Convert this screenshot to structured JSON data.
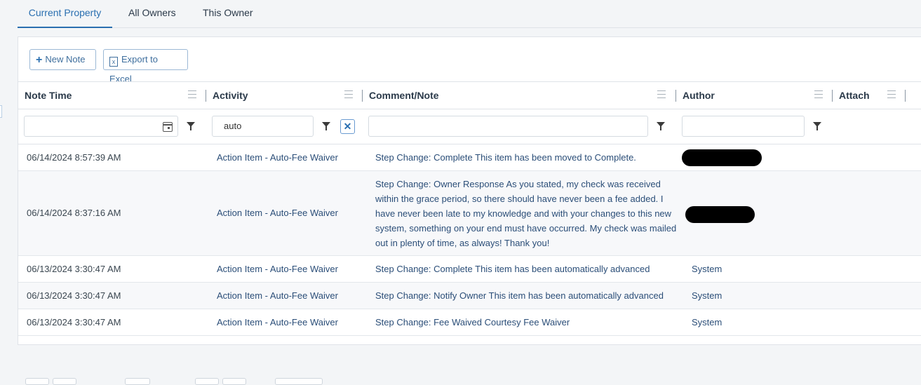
{
  "tabs": [
    {
      "label": "Current Property",
      "active": true
    },
    {
      "label": "All Owners",
      "active": false
    },
    {
      "label": "This Owner",
      "active": false
    }
  ],
  "toolbar": {
    "new_note_label": "New Note",
    "export_label": "Export to Excel"
  },
  "columns": {
    "note_time": "Note Time",
    "activity": "Activity",
    "comment": "Comment/Note",
    "author": "Author",
    "attach": "Attach"
  },
  "filters": {
    "note_time": "",
    "activity": "auto",
    "comment": "",
    "author": ""
  },
  "rows": [
    {
      "time": "06/14/2024 8:57:39 AM",
      "activity": "Action Item - Auto-Fee Waiver",
      "note": "Step Change: Complete This item has been moved to Complete.",
      "author": "",
      "author_redacted": true
    },
    {
      "time": "06/14/2024 8:37:16 AM",
      "activity": "Action Item - Auto-Fee Waiver",
      "note": "Step Change: Owner Response As you stated, my check was received within the grace period, so there should have never been a fee added. I have never been late to my knowledge and with your changes to this new system, something on your end must have occurred. My check was mailed out in plenty of time, as always! Thank you!",
      "author": "",
      "author_redacted": true
    },
    {
      "time": "06/13/2024 3:30:47 AM",
      "activity": "Action Item - Auto-Fee Waiver",
      "note": "Step Change: Complete This item has been automatically advanced",
      "author": "System",
      "author_redacted": false
    },
    {
      "time": "06/13/2024 3:30:47 AM",
      "activity": "Action Item - Auto-Fee Waiver",
      "note": "Step Change: Notify Owner This item has been automatically advanced",
      "author": "System",
      "author_redacted": false
    },
    {
      "time": "06/13/2024 3:30:47 AM",
      "activity": "Action Item - Auto-Fee Waiver",
      "note": "Step Change: Fee Waived Courtesy Fee Waiver",
      "author": "System",
      "author_redacted": false
    }
  ],
  "colors": {
    "accent": "#2a6fb0",
    "link_text": "#2b4e78"
  }
}
